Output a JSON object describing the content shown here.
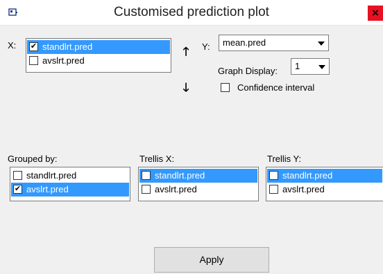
{
  "window": {
    "title": "Customised prediction plot",
    "close_glyph": "×"
  },
  "x_label": "X:",
  "x_list": [
    {
      "label": "standlrt.pred",
      "checked": true,
      "selected": true
    },
    {
      "label": "avslrt.pred",
      "checked": false,
      "selected": false
    }
  ],
  "up_arrow": "🡑",
  "down_arrow": "🡓",
  "y_label": "Y:",
  "y_value": "mean.pred",
  "graph_display_label": "Graph Display:",
  "graph_display_value": "1",
  "confidence_label": "Confidence interval",
  "grouped_by_label": "Grouped by:",
  "grouped_by_list": [
    {
      "label": "standlrt.pred",
      "checked": false,
      "selected": false
    },
    {
      "label": "avslrt.pred",
      "checked": true,
      "selected": true
    }
  ],
  "trellis_x_label": "Trellis X:",
  "trellis_x_list": [
    {
      "label": "standlrt.pred",
      "checked": false,
      "selected": true
    },
    {
      "label": "avslrt.pred",
      "checked": false,
      "selected": false
    }
  ],
  "trellis_y_label": "Trellis Y:",
  "trellis_y_list": [
    {
      "label": "standlrt.pred",
      "checked": false,
      "selected": true
    },
    {
      "label": "avslrt.pred",
      "checked": false,
      "selected": false
    }
  ],
  "apply_label": "Apply",
  "colors": {
    "selection": "#3399ff",
    "close": "#e81123"
  }
}
